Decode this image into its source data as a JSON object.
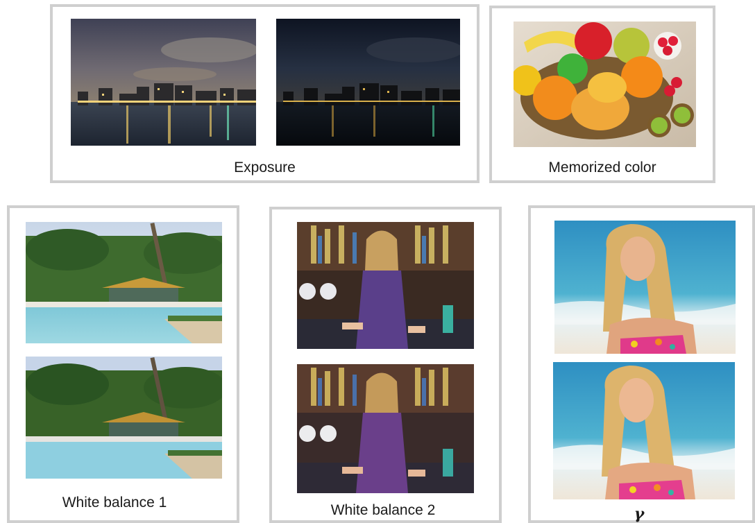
{
  "panels": {
    "exposure": {
      "caption": "Exposure"
    },
    "memorized": {
      "caption": "Memorized color"
    },
    "wb1": {
      "caption": "White balance 1"
    },
    "wb2": {
      "caption": "White balance 2"
    },
    "gamma": {
      "caption": "γ"
    }
  },
  "colors": {
    "panel_border": "#cfcfcf",
    "caption_text": "#1a1a1a"
  }
}
